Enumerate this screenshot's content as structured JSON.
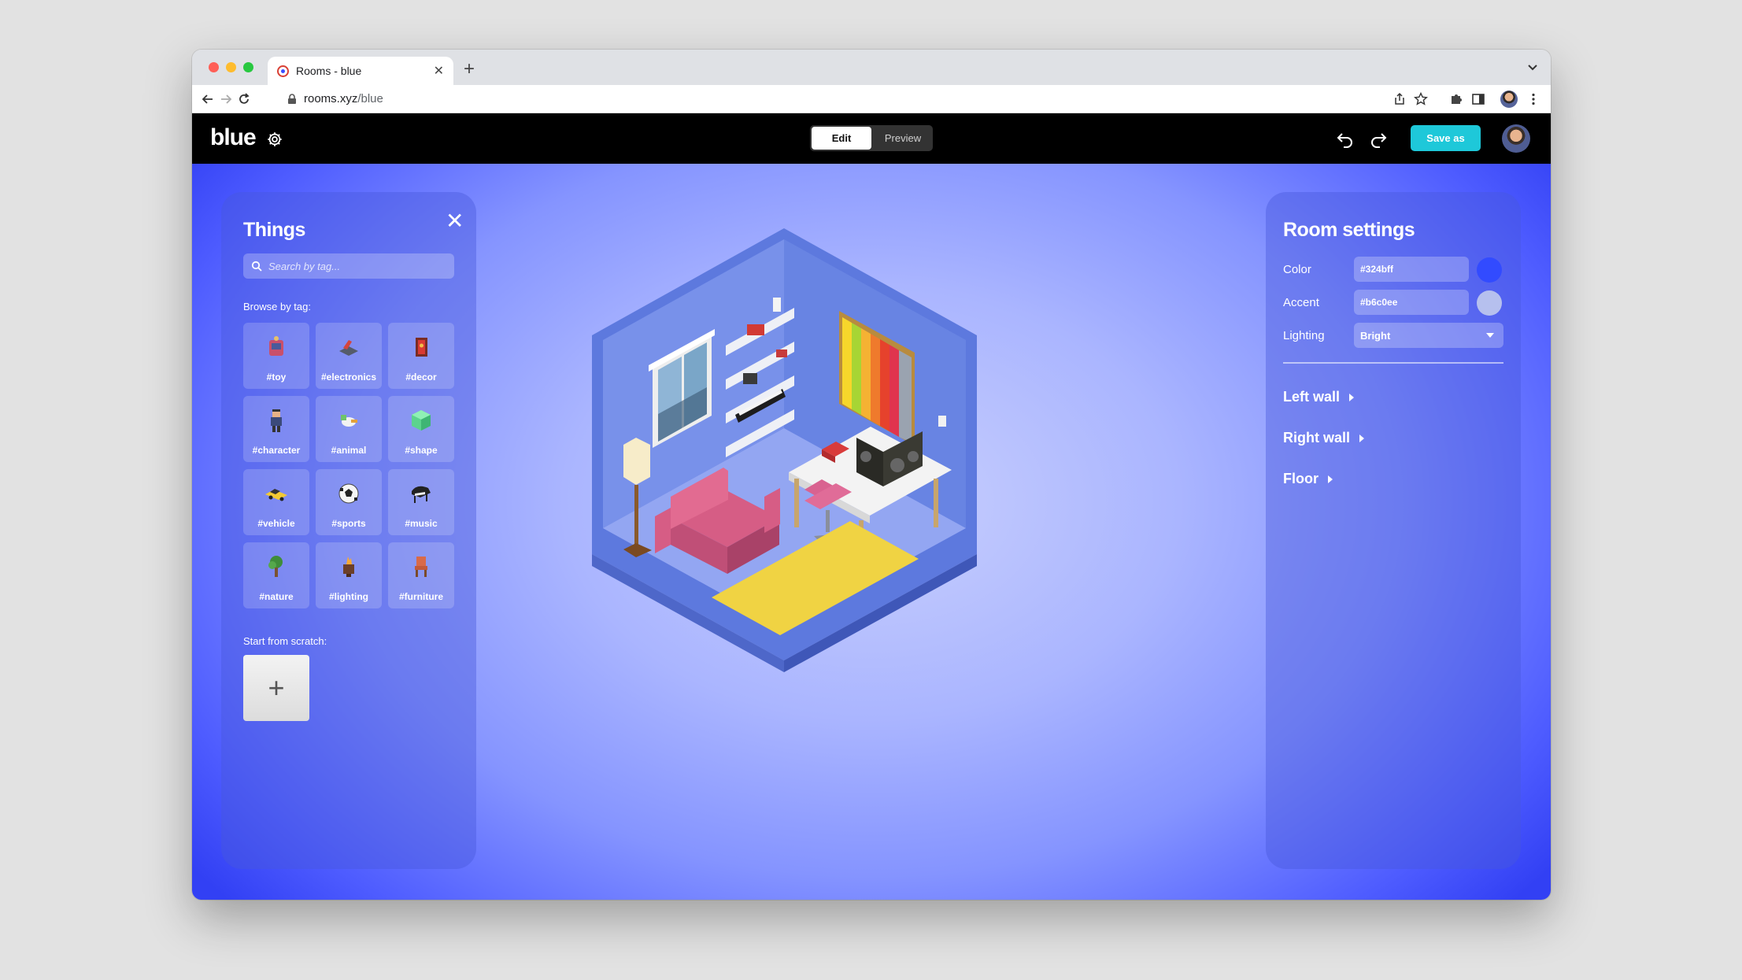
{
  "browser": {
    "tab_title": "Rooms - blue",
    "new_tab_icon": "plus-icon",
    "url_host": "rooms.xyz",
    "url_path": "/blue"
  },
  "app": {
    "logo": "blue",
    "mode_edit": "Edit",
    "mode_preview": "Preview",
    "active_mode": "Edit",
    "save_label": "Save as"
  },
  "things": {
    "title": "Things",
    "search_placeholder": "Search by tag...",
    "browse_label": "Browse by tag:",
    "tags": [
      {
        "label": "#toy",
        "icon": "toy-icon"
      },
      {
        "label": "#electronics",
        "icon": "electronics-icon"
      },
      {
        "label": "#decor",
        "icon": "decor-icon"
      },
      {
        "label": "#character",
        "icon": "character-icon"
      },
      {
        "label": "#animal",
        "icon": "animal-icon"
      },
      {
        "label": "#shape",
        "icon": "shape-icon"
      },
      {
        "label": "#vehicle",
        "icon": "vehicle-icon"
      },
      {
        "label": "#sports",
        "icon": "sports-icon"
      },
      {
        "label": "#music",
        "icon": "music-icon"
      },
      {
        "label": "#nature",
        "icon": "nature-icon"
      },
      {
        "label": "#lighting",
        "icon": "lighting-icon"
      },
      {
        "label": "#furniture",
        "icon": "furniture-icon"
      }
    ],
    "scratch_label": "Start from scratch:",
    "scratch_button": "+"
  },
  "settings": {
    "title": "Room settings",
    "color_label": "Color",
    "color_value": "#324bff",
    "accent_label": "Accent",
    "accent_value": "#b6c0ee",
    "lighting_label": "Lighting",
    "lighting_value": "Bright",
    "sections": [
      "Left wall",
      "Right wall",
      "Floor"
    ]
  },
  "colors": {
    "room": "#324bff",
    "accent": "#b6c0ee",
    "save_button": "#1ec8d9",
    "app_bar": "#000000"
  }
}
